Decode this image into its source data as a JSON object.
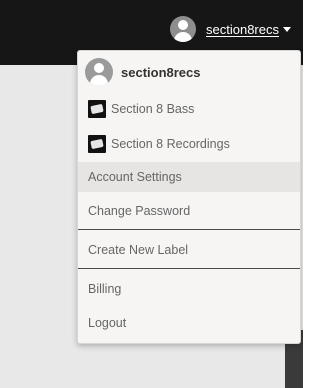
{
  "topbar": {
    "username": "section8recs"
  },
  "dropdown": {
    "username": "section8recs",
    "labels": [
      {
        "name": "Section 8 Bass"
      },
      {
        "name": "Section 8 Recordings"
      }
    ],
    "menu": {
      "account_settings": "Account Settings",
      "change_password": "Change Password",
      "create_new_label": "Create New Label",
      "billing": "Billing",
      "logout": "Logout"
    },
    "active_item": "Account Settings"
  }
}
